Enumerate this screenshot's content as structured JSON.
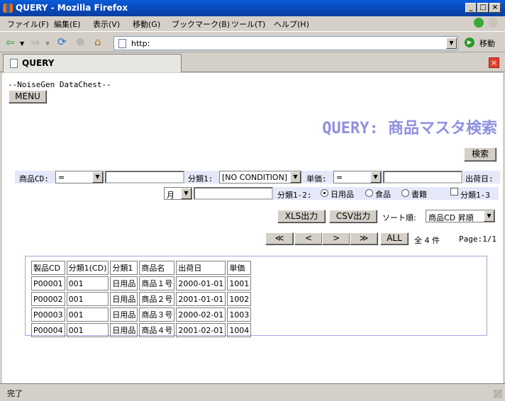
{
  "window": {
    "title": "QUERY - Mozilla Firefox"
  },
  "menubar": [
    "ファイル(F)",
    "編集(E)",
    "表示(V)",
    "移動(G)",
    "ブックマーク(B)",
    "ツール(T)",
    "ヘルプ(H)"
  ],
  "navbar": {
    "url": "http:",
    "go_label": "移動"
  },
  "tab": {
    "label": "QUERY"
  },
  "page": {
    "header_text": "--NoiseGen  DataChest--",
    "menu_button": "MENU",
    "title": "QUERY: 商品マスタ検索",
    "search_button": "検索"
  },
  "search": {
    "product_cd_label": "商品CD:",
    "product_cd_op": "=",
    "category1_label": "分類1:",
    "category1_value": "[NO CONDITION]",
    "price_label": "単価:",
    "price_op": "=",
    "ship_date_label": "出荷日:",
    "ship_date_unit": "月",
    "category12_label": "分類1-2:",
    "radios": [
      {
        "label": "日用品",
        "checked": true
      },
      {
        "label": "食品",
        "checked": false
      },
      {
        "label": "書籍",
        "checked": false
      }
    ],
    "category13_label": "分類1-3"
  },
  "actions": {
    "xls": "XLS出力",
    "csv": "CSV出力",
    "sort_label": "ソート順:",
    "sort_value": "商品CD 昇順"
  },
  "pager": {
    "first": "≪",
    "prev": "<",
    "next": ">",
    "last": "≫",
    "all": "ALL",
    "count_text": "全  4  件",
    "page_text": "Page:1/1"
  },
  "table": {
    "headers": [
      "製品CD",
      "分類1(CD)",
      "分類1",
      "商品名",
      "出荷日",
      "単価"
    ],
    "rows": [
      [
        "P00001",
        "001",
        "日用品",
        "商品１号",
        "2000-01-01",
        "1001"
      ],
      [
        "P00002",
        "001",
        "日用品",
        "商品２号",
        "2001-01-01",
        "1002"
      ],
      [
        "P00003",
        "001",
        "日用品",
        "商品３号",
        "2000-02-01",
        "1003"
      ],
      [
        "P00004",
        "001",
        "日用品",
        "商品４号",
        "2001-02-01",
        "1004"
      ]
    ]
  },
  "status": {
    "text": "完了"
  }
}
